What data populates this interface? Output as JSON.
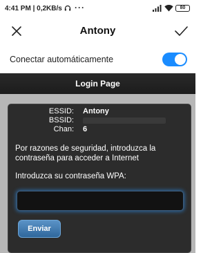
{
  "status_bar": {
    "time": "4:41 PM",
    "net_speed": "0,2KB/s",
    "more": "···",
    "battery": "80"
  },
  "header": {
    "title": "Antony"
  },
  "auto_connect": {
    "label": "Conectar automáticamente",
    "enabled": true
  },
  "login_page": {
    "title": "Login Page",
    "fields": [
      {
        "key": "ESSID:",
        "value": "Antony"
      },
      {
        "key": "BSSID:",
        "value": ""
      },
      {
        "key": "Chan:",
        "value": "6"
      }
    ],
    "notice": "Por razones de seguridad, introduzca la contraseña para acceder a Internet",
    "prompt": "Introduzca su contraseña WPA:",
    "password_value": "",
    "submit_label": "Enviar"
  },
  "colors": {
    "accent": "#1a8cff",
    "panel": "#2c2c2c",
    "button": "#3f7bb2"
  }
}
